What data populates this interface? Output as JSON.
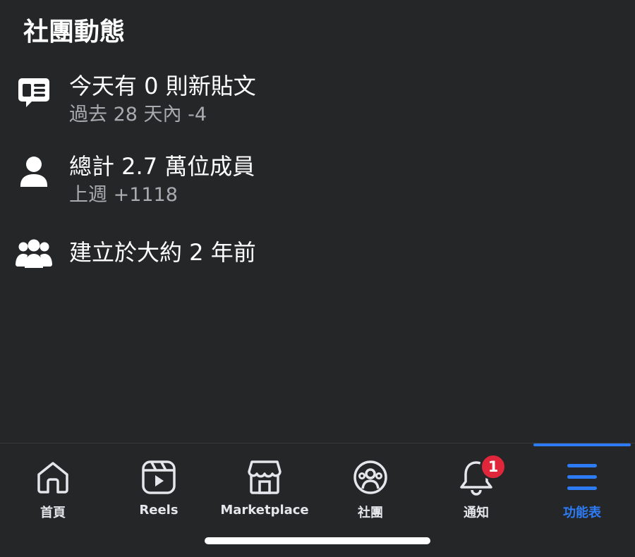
{
  "section": {
    "title": "社團動態"
  },
  "stats": [
    {
      "icon": "posts-icon",
      "main": "今天有 0 則新貼文",
      "sub": "過去 28 天內 -4"
    },
    {
      "icon": "person-icon",
      "main": "總計 2.7 萬位成員",
      "sub": "上週 +1118"
    },
    {
      "icon": "group-icon",
      "main": "建立於大約 2 年前",
      "sub": ""
    }
  ],
  "tabbar": {
    "tabs": [
      {
        "label": "首頁",
        "icon": "home-icon"
      },
      {
        "label": "Reels",
        "icon": "reels-icon"
      },
      {
        "label": "Marketplace",
        "icon": "marketplace-icon"
      },
      {
        "label": "社團",
        "icon": "groups-icon"
      },
      {
        "label": "通知",
        "icon": "bell-icon",
        "badge": "1"
      },
      {
        "label": "功能表",
        "icon": "menu-icon",
        "active": true
      }
    ]
  },
  "colors": {
    "background": "#252628",
    "accent": "#2d7cf6",
    "badge": "#e0263b",
    "secondary_text": "#a8abb0"
  }
}
